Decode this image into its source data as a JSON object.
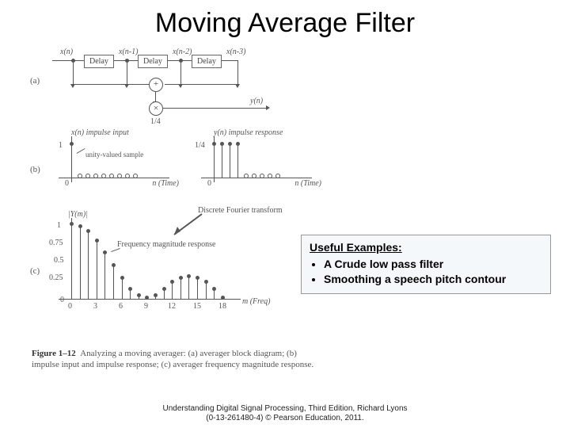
{
  "title": "Moving Average Filter",
  "diagram": {
    "row_a": "(a)",
    "row_b": "(b)",
    "row_c": "(c)",
    "input": "x(n)",
    "tap1": "x(n-1)",
    "tap2": "x(n-2)",
    "tap3": "x(n-3)",
    "delay": "Delay",
    "sum": "+",
    "mult": "×",
    "factor": "1/4",
    "output": "y(n)"
  },
  "impulse": {
    "xin_title": "x(n) impulse input",
    "yout_title": "y(n) impulse response",
    "unity_label": "unity-valued sample",
    "one": "1",
    "quarter": "1/4",
    "zero": "0",
    "xaxis": "n (Time)"
  },
  "dft": {
    "label": "Discrete Fourier transform"
  },
  "freq": {
    "ylabel": "|Y(m)|",
    "label": "Frequency magnitude response",
    "ticks_y": [
      "1",
      "0.75",
      "0.5",
      "0.25",
      "0"
    ],
    "ticks_x": [
      "0",
      "3",
      "6",
      "9",
      "12",
      "15",
      "18"
    ],
    "xaxis": "m (Freq)"
  },
  "chart_data": {
    "type": "bar",
    "title": "Frequency magnitude response |Y(m)|",
    "xlabel": "m (Freq)",
    "ylabel": "|Y(m)|",
    "x": [
      0,
      1,
      2,
      3,
      4,
      5,
      6,
      7,
      8,
      9,
      10,
      11,
      12,
      13,
      14,
      15,
      16,
      17,
      18
    ],
    "values": [
      1.0,
      0.97,
      0.9,
      0.78,
      0.62,
      0.45,
      0.28,
      0.13,
      0.04,
      0.0,
      0.04,
      0.13,
      0.22,
      0.28,
      0.3,
      0.28,
      0.22,
      0.13,
      0.0
    ],
    "ylim": [
      0,
      1
    ]
  },
  "caption": {
    "fignum": "Figure 1–12",
    "text": "Analyzing a moving averager: (a) averager block diagram; (b) impulse input and impulse response; (c) averager frequency magnitude response."
  },
  "useful": {
    "header": "Useful Examples:",
    "item1": "A Crude low pass filter",
    "item2": "Smoothing a speech pitch contour"
  },
  "footer": {
    "line1": "Understanding Digital Signal Processing, Third Edition, Richard Lyons",
    "line2": "(0-13-261480-4) © Pearson Education, 2011."
  }
}
